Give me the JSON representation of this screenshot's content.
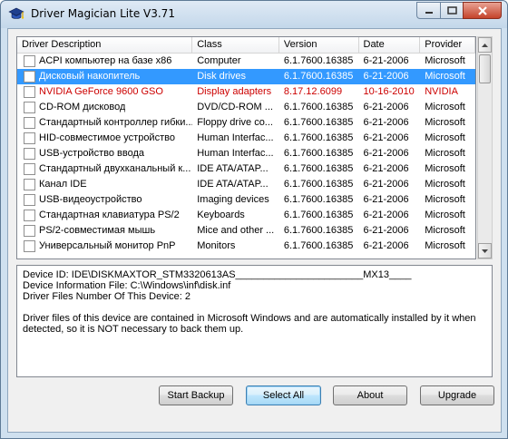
{
  "window": {
    "title": "Driver Magician Lite V3.71",
    "icon": "graduation-cap-icon"
  },
  "list": {
    "columns": [
      "Driver Description",
      "Class",
      "Version",
      "Date",
      "Provider"
    ],
    "rows": [
      {
        "name": "ACPI компьютер на базе x86",
        "class": "Computer",
        "version": "6.1.7600.16385",
        "date": "6-21-2006",
        "provider": "Microsoft",
        "state": "normal"
      },
      {
        "name": "Дисковый накопитель",
        "class": "Disk drives",
        "version": "6.1.7600.16385",
        "date": "6-21-2006",
        "provider": "Microsoft",
        "state": "selected"
      },
      {
        "name": "NVIDIA GeForce 9600 GSO",
        "class": "Display adapters",
        "version": "8.17.12.6099",
        "date": "10-16-2010",
        "provider": "NVIDIA",
        "state": "red"
      },
      {
        "name": "CD-ROM дисковод",
        "class": "DVD/CD-ROM ...",
        "version": "6.1.7600.16385",
        "date": "6-21-2006",
        "provider": "Microsoft",
        "state": "normal"
      },
      {
        "name": "Стандартный контроллер гибки...",
        "class": "Floppy drive co...",
        "version": "6.1.7600.16385",
        "date": "6-21-2006",
        "provider": "Microsoft",
        "state": "normal"
      },
      {
        "name": "HID-совместимое устройство",
        "class": "Human Interfac...",
        "version": "6.1.7600.16385",
        "date": "6-21-2006",
        "provider": "Microsoft",
        "state": "normal"
      },
      {
        "name": "USB-устройство ввода",
        "class": "Human Interfac...",
        "version": "6.1.7600.16385",
        "date": "6-21-2006",
        "provider": "Microsoft",
        "state": "normal"
      },
      {
        "name": "Стандартный двухканальный к...",
        "class": "IDE ATA/ATAP...",
        "version": "6.1.7600.16385",
        "date": "6-21-2006",
        "provider": "Microsoft",
        "state": "normal"
      },
      {
        "name": "Канал IDE",
        "class": "IDE ATA/ATAP...",
        "version": "6.1.7600.16385",
        "date": "6-21-2006",
        "provider": "Microsoft",
        "state": "normal"
      },
      {
        "name": "USB-видеоустройство",
        "class": "Imaging devices",
        "version": "6.1.7600.16385",
        "date": "6-21-2006",
        "provider": "Microsoft",
        "state": "normal"
      },
      {
        "name": "Стандартная клавиатура PS/2",
        "class": "Keyboards",
        "version": "6.1.7600.16385",
        "date": "6-21-2006",
        "provider": "Microsoft",
        "state": "normal"
      },
      {
        "name": "PS/2-совместимая мышь",
        "class": "Mice and other ...",
        "version": "6.1.7600.16385",
        "date": "6-21-2006",
        "provider": "Microsoft",
        "state": "normal"
      },
      {
        "name": "Универсальный монитор PnP",
        "class": "Monitors",
        "version": "6.1.7600.16385",
        "date": "6-21-2006",
        "provider": "Microsoft",
        "state": "normal"
      }
    ]
  },
  "info": {
    "device_id": "Device ID: IDE\\DISKMAXTOR_STM3320613AS_______________________MX13____",
    "info_file": "Device Information File: C:\\Windows\\inf\\disk.inf",
    "file_count": "Driver Files Number Of This Device: 2",
    "note": "Driver files of this device are contained in Microsoft Windows and are automatically installed by it when detected, so it is NOT necessary to back them up."
  },
  "buttons": {
    "start_backup": "Start Backup",
    "select_all": "Select All",
    "about": "About",
    "upgrade": "Upgrade"
  },
  "colors": {
    "selection": "#3399ff",
    "highlight_text": "#cc0000"
  }
}
